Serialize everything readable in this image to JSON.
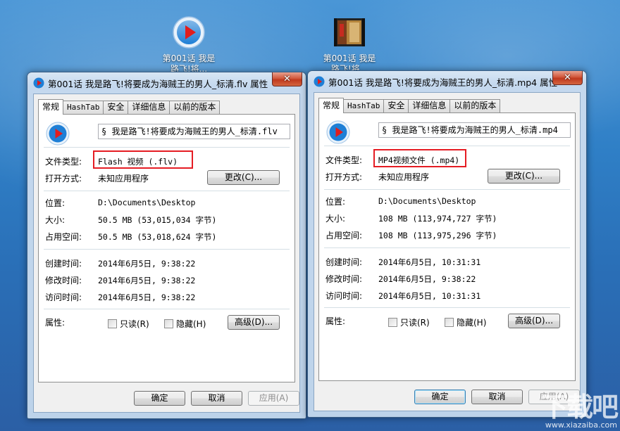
{
  "desktop": {
    "icons": [
      {
        "label": "第001话 我是路飞!将...",
        "icon": "play-video-icon"
      },
      {
        "label": "第001话 我是路飞!将...",
        "icon": "video-thumbnail-icon"
      }
    ]
  },
  "tabs": [
    "常规",
    "HashTab",
    "安全",
    "详细信息",
    "以前的版本"
  ],
  "labels": {
    "file_type": "文件类型:",
    "open_with": "打开方式:",
    "location": "位置:",
    "size": "大小:",
    "size_on_disk": "占用空间:",
    "created": "创建时间:",
    "modified": "修改时间:",
    "accessed": "访问时间:",
    "attributes": "属性:",
    "readonly": "只读(R)",
    "hidden": "隐藏(H)",
    "advanced": "高级(D)...",
    "change": "更改(C)...",
    "ok": "确定",
    "cancel": "取消",
    "apply": "应用(A)"
  },
  "windows": [
    {
      "title": "第001话 我是路飞!将要成为海贼王的男人_标清.flv 属性",
      "filename": "§ 我是路飞!将要成为海贼王的男人_标清.flv",
      "file_type": "Flash 视频 (.flv)",
      "open_with": "未知应用程序",
      "location": "D:\\Documents\\Desktop",
      "size": "50.5 MB (53,015,034 字节)",
      "size_on_disk": "50.5 MB (53,018,624 字节)",
      "created": "2014年6月5日, 9:38:22",
      "modified": "2014年6月5日, 9:38:22",
      "accessed": "2014年6月5日, 9:38:22"
    },
    {
      "title": "第001话 我是路飞!将要成为海贼王的男人_标清.mp4 属性",
      "filename": "§ 我是路飞!将要成为海贼王的男人_标清.mp4",
      "file_type": "MP4视频文件 (.mp4)",
      "open_with": "未知应用程序",
      "location": "D:\\Documents\\Desktop",
      "size": "108 MB (113,974,727 字节)",
      "size_on_disk": "108 MB (113,975,296 字节)",
      "created": "2014年6月5日, 10:31:31",
      "modified": "2014年6月5日, 9:38:22",
      "accessed": "2014年6月5日, 10:31:31"
    }
  ],
  "watermark": {
    "logo": "下载吧",
    "url": "www.xiazaiba.com"
  },
  "colors": {
    "highlight": "#e51c23",
    "play_icon": "#1e7fd6"
  }
}
